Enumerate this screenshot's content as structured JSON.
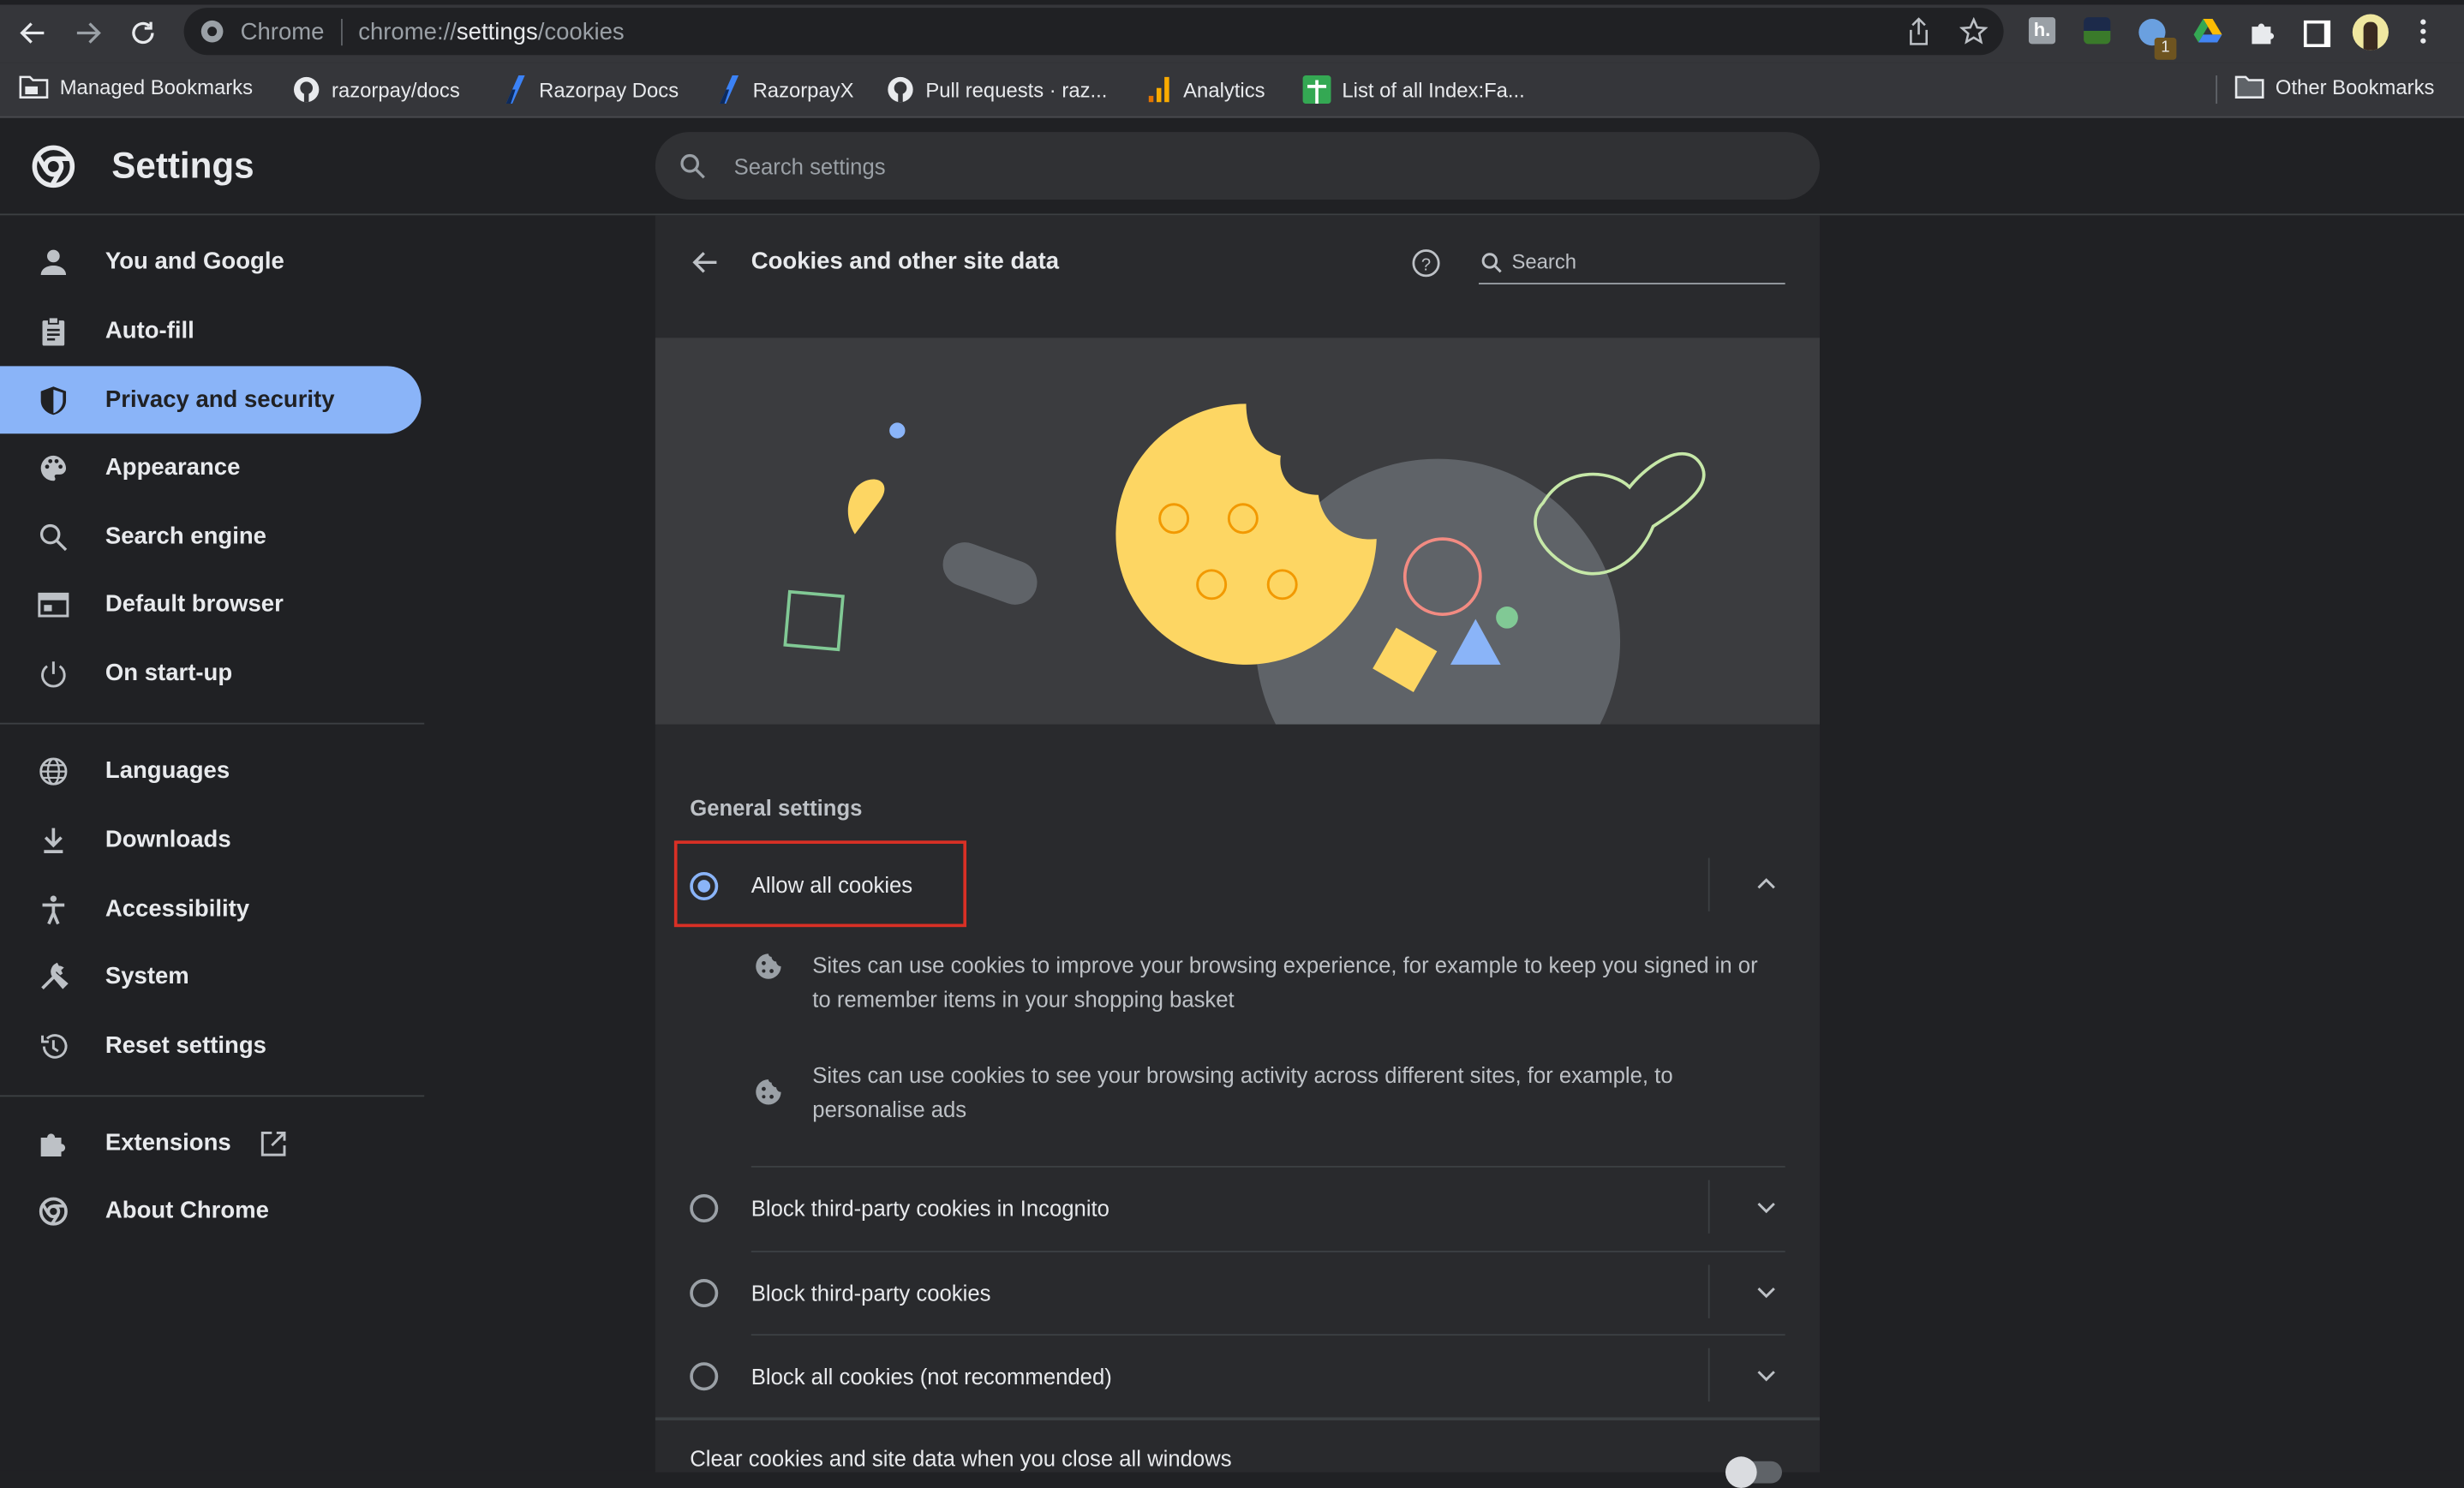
{
  "browser": {
    "address_prefix": "Chrome",
    "url_scheme": "chrome://",
    "url_host": "settings",
    "url_path": "/cookies",
    "extension_badge": "1",
    "bookmarks": [
      {
        "label": "Managed Bookmarks",
        "icon": "folder-managed-icon"
      },
      {
        "label": "razorpay/docs",
        "icon": "github-icon"
      },
      {
        "label": "Razorpay Docs",
        "icon": "razorpay-icon"
      },
      {
        "label": "RazorpayX",
        "icon": "razorpay-icon"
      },
      {
        "label": "Pull requests · raz...",
        "icon": "github-icon"
      },
      {
        "label": "Analytics",
        "icon": "analytics-icon"
      },
      {
        "label": "List of all Index:Fa...",
        "icon": "sheets-icon"
      }
    ],
    "other_bookmarks": "Other Bookmarks"
  },
  "settings": {
    "title": "Settings",
    "search_placeholder": "Search settings"
  },
  "sidebar": {
    "items": [
      {
        "label": "You and Google",
        "icon": "person-icon"
      },
      {
        "label": "Auto-fill",
        "icon": "clipboard-icon"
      },
      {
        "label": "Privacy and security",
        "icon": "shield-icon",
        "selected": true
      },
      {
        "label": "Appearance",
        "icon": "palette-icon"
      },
      {
        "label": "Search engine",
        "icon": "search-icon"
      },
      {
        "label": "Default browser",
        "icon": "browser-icon"
      },
      {
        "label": "On start-up",
        "icon": "power-icon"
      },
      {
        "label": "Languages",
        "icon": "globe-icon"
      },
      {
        "label": "Downloads",
        "icon": "download-icon"
      },
      {
        "label": "Accessibility",
        "icon": "accessibility-icon"
      },
      {
        "label": "System",
        "icon": "wrench-icon"
      },
      {
        "label": "Reset settings",
        "icon": "history-icon"
      },
      {
        "label": "Extensions",
        "icon": "puzzle-icon"
      },
      {
        "label": "About Chrome",
        "icon": "chrome-icon"
      }
    ]
  },
  "page": {
    "title": "Cookies and other site data",
    "search_placeholder": "Search",
    "section_label": "General settings",
    "options": [
      {
        "label": "Allow all cookies",
        "selected": true,
        "expanded": true
      },
      {
        "label": "Block third-party cookies in Incognito",
        "selected": false
      },
      {
        "label": "Block third-party cookies",
        "selected": false
      },
      {
        "label": "Block all cookies (not recommended)",
        "selected": false
      }
    ],
    "allow_details": [
      "Sites can use cookies to improve your browsing experience, for example to keep you signed in or to remember items in your shopping basket",
      "Sites can use cookies to see your browsing activity across different sites, for example, to personalise ads"
    ],
    "clear_on_exit_label": "Clear cookies and site data when you close all windows",
    "clear_on_exit_enabled": false
  },
  "colors": {
    "accent": "#8ab4f8",
    "highlight_box": "#d93025",
    "cookie": "#fdd663"
  }
}
